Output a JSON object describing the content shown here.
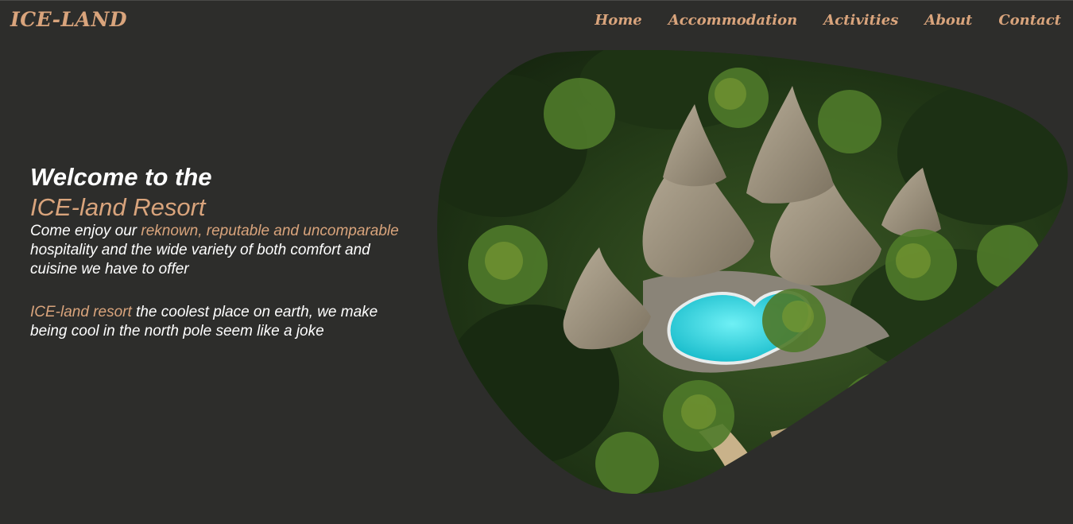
{
  "header": {
    "logo": "ICE-LAND",
    "nav": [
      "Home",
      "Accommodation",
      "Activities",
      "About",
      "Contact"
    ]
  },
  "hero": {
    "title": "Welcome to the",
    "brand": "ICE-land Resort",
    "para1_pre": "Come enjoy our ",
    "para1_accent": "reknown, reputable and uncomparable",
    "para1_post": " hospitality and the wide variety of both comfort and cuisine we have to offer",
    "para2_accent": "ICE-land resort",
    "para2_post": " the coolest place on earth, we make being cool in the north pole seem like a joke"
  },
  "colors": {
    "background": "#2d2d2b",
    "accent": "#d9a47c",
    "text": "#ffffff"
  }
}
